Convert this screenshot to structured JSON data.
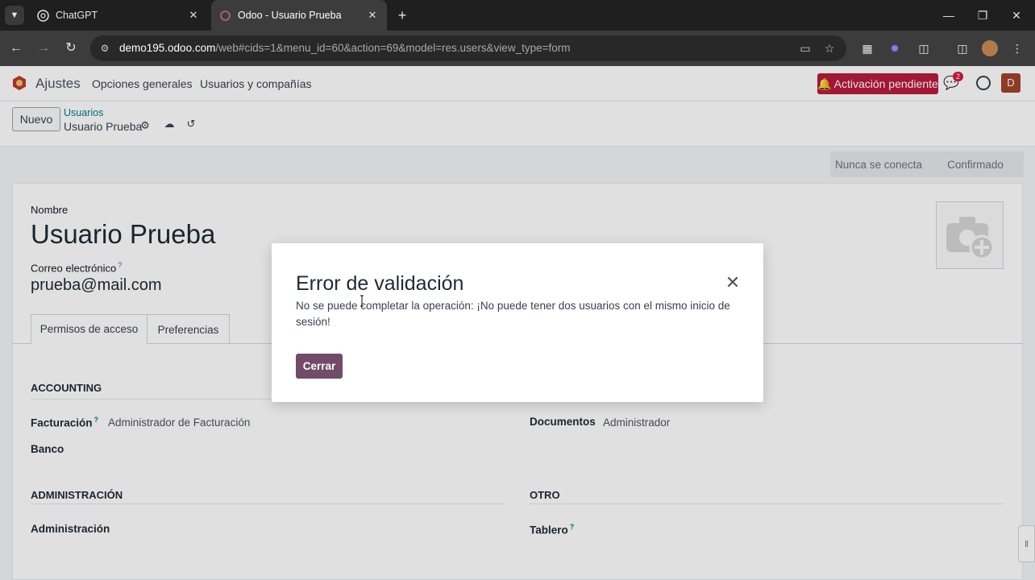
{
  "browser": {
    "tabs": [
      {
        "title": "ChatGPT",
        "icon": "chatgpt-icon",
        "active": false
      },
      {
        "title": "Odoo - Usuario Prueba",
        "icon": "odoo-icon",
        "active": true
      }
    ],
    "url_domain": "demo195.odoo.com",
    "url_rest": "/web#cids=1&menu_id=60&action=69&model=res.users&view_type=form"
  },
  "navbar": {
    "app_name": "Ajustes",
    "menus": [
      "Opciones generales",
      "Usuarios y compañías"
    ],
    "activation_label": "Activación pendiente",
    "chat_badge": "2",
    "avatar_letter": "D"
  },
  "control": {
    "new_label": "Nuevo",
    "breadcrumb_parent": "Usuarios",
    "breadcrumb_current": "Usuario Prueba"
  },
  "status": [
    "Nunca se conecta",
    "Confirmado"
  ],
  "form": {
    "name_label": "Nombre",
    "name_value": "Usuario Prueba",
    "email_label": "Correo electrónico",
    "email_help": "?",
    "email_value": "prueba@mail.com",
    "tabs": [
      "Permisos de acceso",
      "Preferencias"
    ],
    "sections": {
      "accounting": "ACCOUNTING",
      "administracion": "ADMINISTRACIÓN",
      "otro": "OTRO"
    },
    "fields": {
      "facturacion_label": "Facturación",
      "facturacion_help": "?",
      "facturacion_value": "Administrador de Facturación",
      "banco_label": "Banco",
      "documentos_label": "Documentos",
      "documentos_value": "Administrador",
      "administracion_label": "Administración",
      "tablero_label": "Tablero",
      "tablero_help": "?"
    }
  },
  "modal": {
    "title": "Error de validación",
    "body": "No se puede completar la operación: ¡No puede tener dos usuarios con el mismo inicio de sesión!",
    "button": "Cerrar"
  },
  "colors": {
    "odoo_primary": "#714b67",
    "activation_red": "#b91c3c",
    "breadcrumb_link": "#017e84"
  }
}
